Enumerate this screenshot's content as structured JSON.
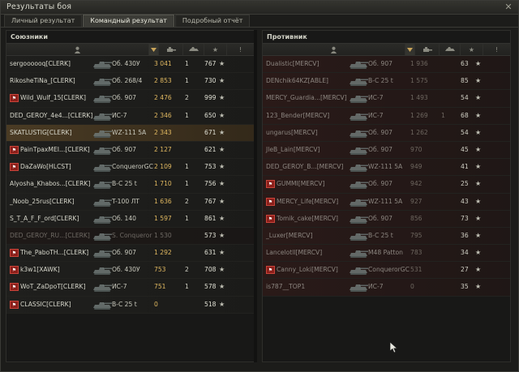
{
  "window": {
    "title": "Результаты боя"
  },
  "tabs": [
    {
      "label": "Личный результат",
      "active": false
    },
    {
      "label": "Командный результат",
      "active": true
    },
    {
      "label": "Подробный отчёт",
      "active": false
    }
  ],
  "columns_icons": [
    "player-icon",
    "sort-arrow-icon",
    "tank-icon",
    "damage-icon",
    "frags-icon",
    "xp-star-icon",
    "info-icon"
  ],
  "allies": {
    "title": "Союзники",
    "rows": [
      {
        "badge": false,
        "player": "sergoooooq[CLERK]",
        "vehicle": "Об. 430У",
        "damage": "3 041",
        "frags": "1",
        "xp": "767",
        "state": "alive"
      },
      {
        "badge": false,
        "player": "RikosheTiNa_[CLERK]",
        "vehicle": "Об. 268/4",
        "damage": "2 853",
        "frags": "1",
        "xp": "730",
        "state": "alive"
      },
      {
        "badge": true,
        "player": "Wild_Wulf_15[CLERK]",
        "vehicle": "Об. 907",
        "damage": "2 476",
        "frags": "2",
        "xp": "999",
        "state": "alive"
      },
      {
        "badge": false,
        "player": "DED_GEROY_4e4...[CLERK]",
        "vehicle": "ИС-7",
        "damage": "2 346",
        "frags": "1",
        "xp": "650",
        "state": "alive"
      },
      {
        "badge": false,
        "player": "SKATLUSTIG[CLERK]",
        "vehicle": "WZ-111 5A",
        "damage": "2 343",
        "frags": "",
        "xp": "671",
        "state": "self"
      },
      {
        "badge": true,
        "player": "PainTpaxMEI...[CLERK]",
        "vehicle": "Об. 907",
        "damage": "2 127",
        "frags": "",
        "xp": "621",
        "state": "alive"
      },
      {
        "badge": true,
        "player": "DaZaWo[HLCST]",
        "vehicle": "ConquerorGC",
        "damage": "2 109",
        "frags": "1",
        "xp": "753",
        "state": "alive"
      },
      {
        "badge": false,
        "player": "Alyosha_Khabos...[CLERK]",
        "vehicle": "B-C 25 t",
        "damage": "1 710",
        "frags": "1",
        "xp": "756",
        "state": "alive"
      },
      {
        "badge": false,
        "player": "_Noob_25rus[CLERK]",
        "vehicle": "T-100 ЛТ",
        "damage": "1 636",
        "frags": "2",
        "xp": "767",
        "state": "alive"
      },
      {
        "badge": false,
        "player": "S_T_A_F_F_ord[CLERK]",
        "vehicle": "Об. 140",
        "damage": "1 597",
        "frags": "1",
        "xp": "861",
        "state": "alive"
      },
      {
        "badge": false,
        "player": "DED_GEROY_RU...[CLERK]",
        "vehicle": "S. Conqueror",
        "damage": "1 530",
        "frags": "",
        "xp": "573",
        "state": "dead"
      },
      {
        "badge": true,
        "player": "The_PaboTH...[CLERK]",
        "vehicle": "Об. 907",
        "damage": "1 292",
        "frags": "",
        "xp": "631",
        "state": "alive"
      },
      {
        "badge": true,
        "player": "k3w1[XAWK]",
        "vehicle": "Об. 430У",
        "damage": "753",
        "frags": "2",
        "xp": "708",
        "state": "alive"
      },
      {
        "badge": true,
        "player": "WoT_ZaDpoT[CLERK]",
        "vehicle": "ИС-7",
        "damage": "751",
        "frags": "1",
        "xp": "578",
        "state": "alive"
      },
      {
        "badge": true,
        "player": "CLASSIC[CLERK]",
        "vehicle": "B-C 25 t",
        "damage": "0",
        "frags": "",
        "xp": "518",
        "state": "alive"
      }
    ]
  },
  "enemies": {
    "title": "Противник",
    "rows": [
      {
        "badge": false,
        "player": "Dualistic[MERCV]",
        "vehicle": "Об. 907",
        "damage": "1 936",
        "frags": "",
        "xp": "63",
        "state": "enemy"
      },
      {
        "badge": false,
        "player": "DENchik64KZ[ABLE]",
        "vehicle": "B-C 25 t",
        "damage": "1 575",
        "frags": "",
        "xp": "85",
        "state": "enemy"
      },
      {
        "badge": false,
        "player": "MERCY_Guardia...[MERCV]",
        "vehicle": "ИС-7",
        "damage": "1 493",
        "frags": "",
        "xp": "54",
        "state": "enemy"
      },
      {
        "badge": false,
        "player": "123_Bender[MERCV]",
        "vehicle": "ИС-7",
        "damage": "1 269",
        "frags": "1",
        "xp": "68",
        "state": "enemy"
      },
      {
        "badge": false,
        "player": "ungarus[MERCV]",
        "vehicle": "Об. 907",
        "damage": "1 262",
        "frags": "",
        "xp": "54",
        "state": "enemy"
      },
      {
        "badge": false,
        "player": "JleB_Lain[MERCV]",
        "vehicle": "Об. 907",
        "damage": "970",
        "frags": "",
        "xp": "45",
        "state": "enemy"
      },
      {
        "badge": false,
        "player": "DED_GEROY_B...[MERCV]",
        "vehicle": "WZ-111 5A",
        "damage": "949",
        "frags": "",
        "xp": "41",
        "state": "enemy"
      },
      {
        "badge": true,
        "player": "GUMMI[MERCV]",
        "vehicle": "Об. 907",
        "damage": "942",
        "frags": "",
        "xp": "25",
        "state": "enemy"
      },
      {
        "badge": true,
        "player": "MERCY_Life[MERCV]",
        "vehicle": "WZ-111 5A",
        "damage": "927",
        "frags": "",
        "xp": "43",
        "state": "enemy"
      },
      {
        "badge": true,
        "player": "Tomik_cake[MERCV]",
        "vehicle": "Об. 907",
        "damage": "856",
        "frags": "",
        "xp": "73",
        "state": "enemy"
      },
      {
        "badge": false,
        "player": "_Luxer[MERCV]",
        "vehicle": "B-C 25 t",
        "damage": "795",
        "frags": "",
        "xp": "36",
        "state": "enemy"
      },
      {
        "badge": false,
        "player": "Lancelotll[MERCV]",
        "vehicle": "M48 Patton",
        "damage": "783",
        "frags": "",
        "xp": "34",
        "state": "enemy"
      },
      {
        "badge": true,
        "player": "Canny_Loki[MERCV]",
        "vehicle": "ConquerorGC",
        "damage": "531",
        "frags": "",
        "xp": "27",
        "state": "enemy"
      },
      {
        "badge": false,
        "player": "is787__TOP1",
        "vehicle": "ИС-7",
        "damage": "0",
        "frags": "",
        "xp": "35",
        "state": "enemy"
      }
    ]
  }
}
